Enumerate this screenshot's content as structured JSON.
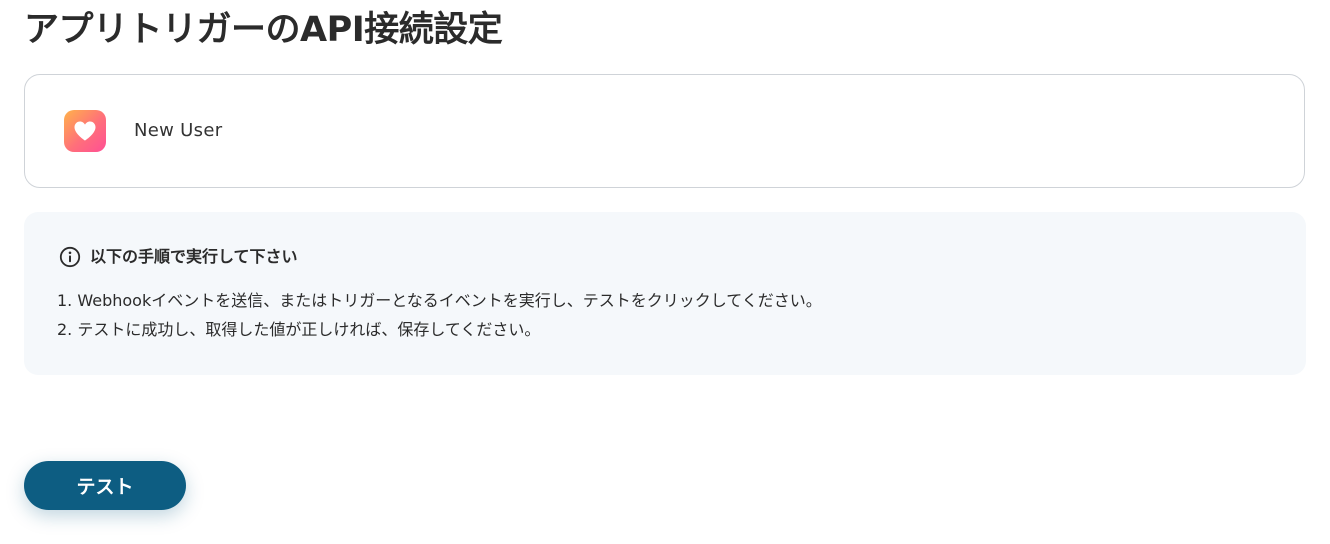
{
  "header": {
    "title": "アプリトリガーのAPI接続設定"
  },
  "trigger": {
    "icon": "heart-app-icon",
    "name": "New User"
  },
  "instructions": {
    "icon": "info-icon",
    "title": "以下の手順で実行して下さい",
    "steps": [
      "1. Webhookイベントを送信、またはトリガーとなるイベントを実行し、テストをクリックしてください。",
      "2. テストに成功し、取得した値が正しければ、保存してください。"
    ]
  },
  "actions": {
    "test_label": "テスト"
  },
  "colors": {
    "primary_button": "#0d5d82",
    "info_background": "#f5f8fb",
    "card_border": "#cfd3d8",
    "app_icon_gradient": [
      "#ffb24a",
      "#ff6f7a",
      "#ff4f95"
    ]
  }
}
